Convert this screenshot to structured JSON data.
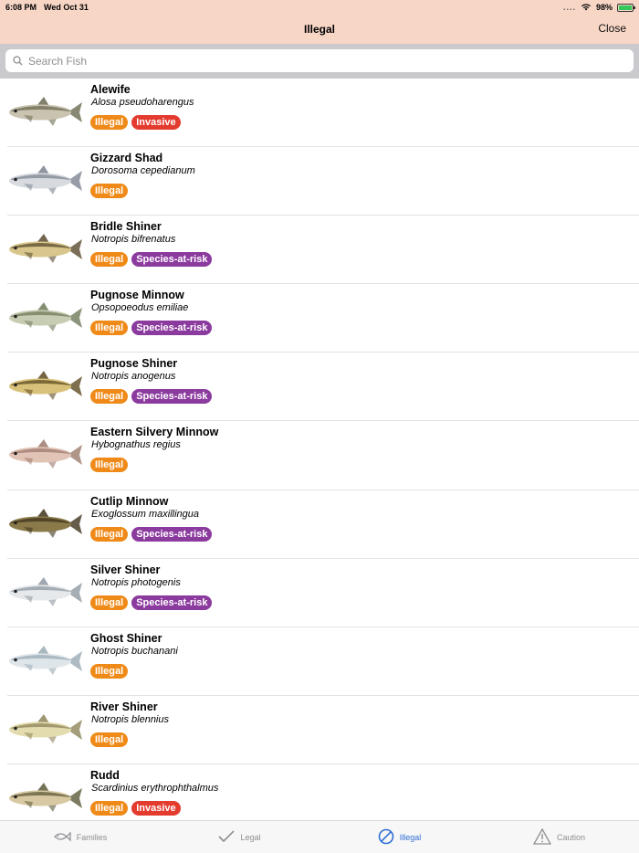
{
  "status": {
    "time": "6:08 PM",
    "date": "Wed Oct 31",
    "battery": "98%",
    "signal_dots": "....",
    "battery_level": 0.98
  },
  "nav": {
    "title": "Illegal",
    "close_label": "Close"
  },
  "search": {
    "placeholder": "Search Fish"
  },
  "fish": [
    {
      "common": "Alewife",
      "scientific": "Alosa pseudoharengus",
      "tags": [
        "Illegal",
        "Invasive"
      ],
      "body_color": "#c9c3b0",
      "back_color": "#6b6a52"
    },
    {
      "common": "Gizzard Shad",
      "scientific": "Dorosoma cepedianum",
      "tags": [
        "Illegal"
      ],
      "body_color": "#d7dbe0",
      "back_color": "#7d8590"
    },
    {
      "common": "Bridle Shiner",
      "scientific": "Notropis bifrenatus",
      "tags": [
        "Illegal",
        "Species-at-risk"
      ],
      "body_color": "#d8c68c",
      "back_color": "#5a4a2e"
    },
    {
      "common": "Pugnose Minnow",
      "scientific": "Opsopoeodus emiliae",
      "tags": [
        "Illegal",
        "Species-at-risk"
      ],
      "body_color": "#c7cdb3",
      "back_color": "#6f7a5a"
    },
    {
      "common": "Pugnose Shiner",
      "scientific": "Notropis anogenus",
      "tags": [
        "Illegal",
        "Species-at-risk"
      ],
      "body_color": "#d8c27a",
      "back_color": "#5e4b22"
    },
    {
      "common": "Eastern Silvery Minnow",
      "scientific": "Hybognathus regius",
      "tags": [
        "Illegal"
      ],
      "body_color": "#e2c4b7",
      "back_color": "#9c7a6c"
    },
    {
      "common": "Cutlip Minnow",
      "scientific": "Exoglossum maxillingua",
      "tags": [
        "Illegal",
        "Species-at-risk"
      ],
      "body_color": "#8a7a4a",
      "back_color": "#3e331c"
    },
    {
      "common": "Silver Shiner",
      "scientific": "Notropis photogenis",
      "tags": [
        "Illegal",
        "Species-at-risk"
      ],
      "body_color": "#e6e9ec",
      "back_color": "#8f98a2"
    },
    {
      "common": "Ghost Shiner",
      "scientific": "Notropis buchanani",
      "tags": [
        "Illegal"
      ],
      "body_color": "#dfe6ea",
      "back_color": "#9aaab4"
    },
    {
      "common": "River Shiner",
      "scientific": "Notropis blennius",
      "tags": [
        "Illegal"
      ],
      "body_color": "#e3dcae",
      "back_color": "#8c8458"
    },
    {
      "common": "Rudd",
      "scientific": "Scardinius erythrophthalmus",
      "tags": [
        "Illegal",
        "Invasive"
      ],
      "body_color": "#d9c9a2",
      "back_color": "#5d5a3a"
    }
  ],
  "tabs": [
    {
      "label": "Families",
      "icon": "fish-icon"
    },
    {
      "label": "Legal",
      "icon": "checkmark-icon"
    },
    {
      "label": "Illegal",
      "icon": "prohibited-icon"
    },
    {
      "label": "Caution",
      "icon": "warning-icon"
    }
  ],
  "colors": {
    "header_bg": "#f8d6c6",
    "illegal": "#ef8a18",
    "invasive": "#e43b2f",
    "species_at_risk": "#8b3a9e",
    "active_tab": "#2f6fd6"
  }
}
